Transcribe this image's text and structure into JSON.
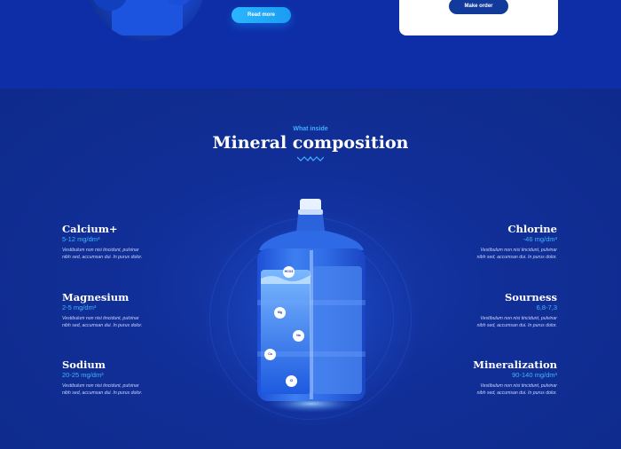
{
  "top": {
    "read_more_label": "Read more",
    "make_order_label": "Make order"
  },
  "mineral": {
    "eyebrow": "What inside",
    "title": "Mineral composition",
    "items_left": [
      {
        "name": "Calcium+",
        "value": "5-12 mg/dm³",
        "desc1": "Vestibulum non nisi tincidunt, pulvinar",
        "desc2": "nibh sed, accumsan dui. In purus dolor."
      },
      {
        "name": "Magnesium",
        "value": "2-5 mg/dm³",
        "desc1": "Vestibulum non nisi tincidunt, pulvinar",
        "desc2": "nibh sed, accumsan dui. In purus dolor."
      },
      {
        "name": "Sodium",
        "value": "20-25 mg/dm³",
        "desc1": "Vestibulum non nisi tincidunt, pulvinar",
        "desc2": "nibh sed, accumsan dui. In purus dolor."
      }
    ],
    "items_right": [
      {
        "name": "Chlorine",
        "value": "-46 mg/dm³",
        "desc1": "Vestibulum non nisi tincidunt, pulvinar",
        "desc2": "nibh sed, accumsan dui. In purus dolor."
      },
      {
        "name": "Sourness",
        "value": "6,8-7,3",
        "desc1": "Vestibulum non nisi tincidunt, pulvinar",
        "desc2": "nibh sed, accumsan dui. In purus dolor."
      },
      {
        "name": "Mineralization",
        "value": "90-140 mg/dm³",
        "desc1": "Vestibulum non nisi tincidunt, pulvinar",
        "desc2": "nibh sed, accumsan dui. In purus dolor."
      }
    ],
    "bubbles": [
      "HCO3",
      "Mg",
      "Na",
      "Ca",
      "Cl"
    ]
  },
  "colors": {
    "background": "#0f2a8c",
    "accent": "#40b4ff",
    "button": "#1a9cf2",
    "card": "#ffffff"
  }
}
